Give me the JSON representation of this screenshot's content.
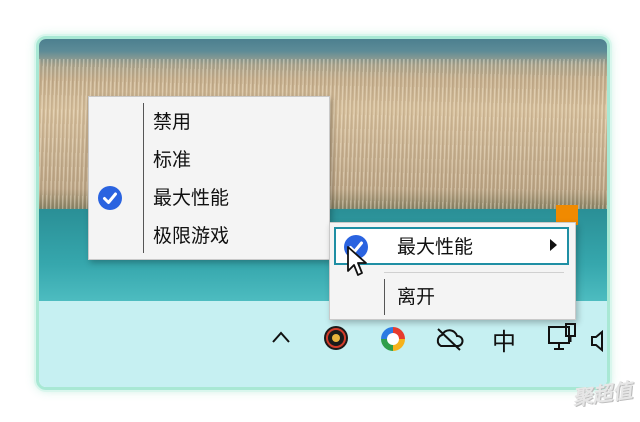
{
  "left_menu": {
    "items": [
      {
        "label": "禁用",
        "checked": false
      },
      {
        "label": "标准",
        "checked": false
      },
      {
        "label": "最大性能",
        "checked": true
      },
      {
        "label": "极限游戏",
        "checked": false
      }
    ]
  },
  "right_menu": {
    "items": [
      {
        "label": "最大性能",
        "checked": true,
        "has_submenu": true,
        "hovered": true
      },
      {
        "label": "离开",
        "checked": false
      }
    ]
  },
  "tray": {
    "ime_label": "中",
    "icons": [
      "chevron-up-icon",
      "qnap-app-icon",
      "copilot-icon",
      "cloud-off-icon",
      "ime-indicator",
      "network-icon"
    ]
  },
  "watermark": "聚超值",
  "colors": {
    "check_blue": "#2a63e0",
    "hover_border": "#1f8fa4",
    "taskbar": "#c6f0f2",
    "frame_border": "#a8e8d4"
  }
}
